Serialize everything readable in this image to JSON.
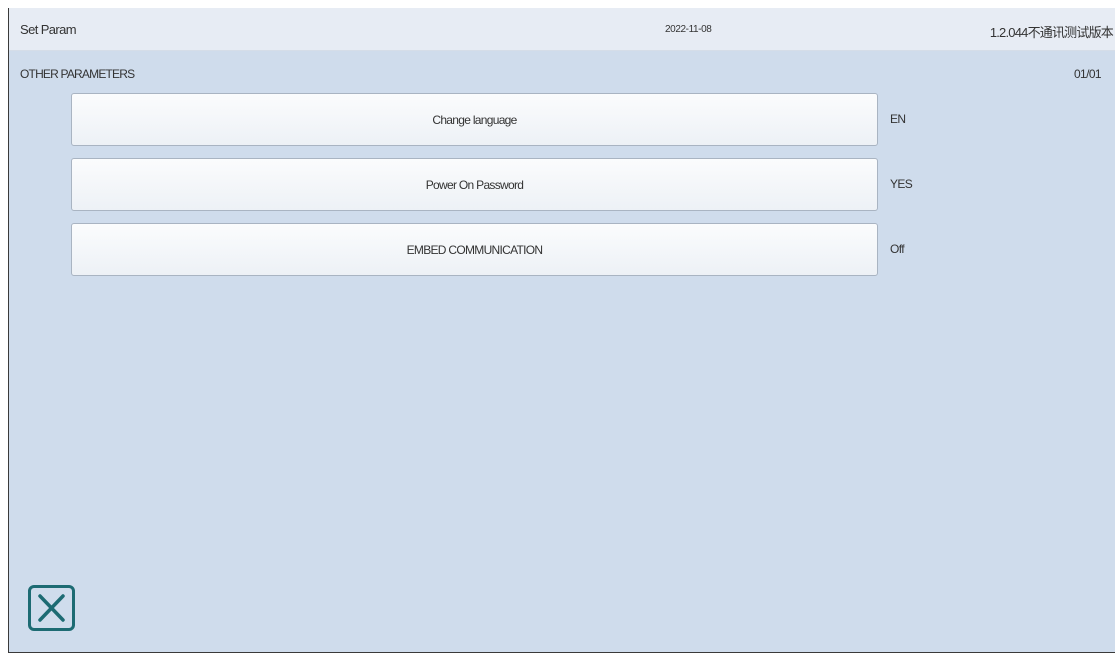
{
  "header": {
    "title": "Set Param",
    "date": "2022-11-08",
    "version": "1.2.044不通讯测试版本"
  },
  "section": {
    "title": "OTHER PARAMETERS",
    "page": "01/01"
  },
  "params": [
    {
      "label": "Change language",
      "value": "EN"
    },
    {
      "label": "Power On Password",
      "value": "YES"
    },
    {
      "label": "EMBED COMMUNICATION",
      "value": "Off"
    }
  ],
  "icons": {
    "close": "close-icon"
  },
  "colors": {
    "background": "#cfdcec",
    "header": "#e7ecf4",
    "close_icon": "#1d6b73"
  }
}
